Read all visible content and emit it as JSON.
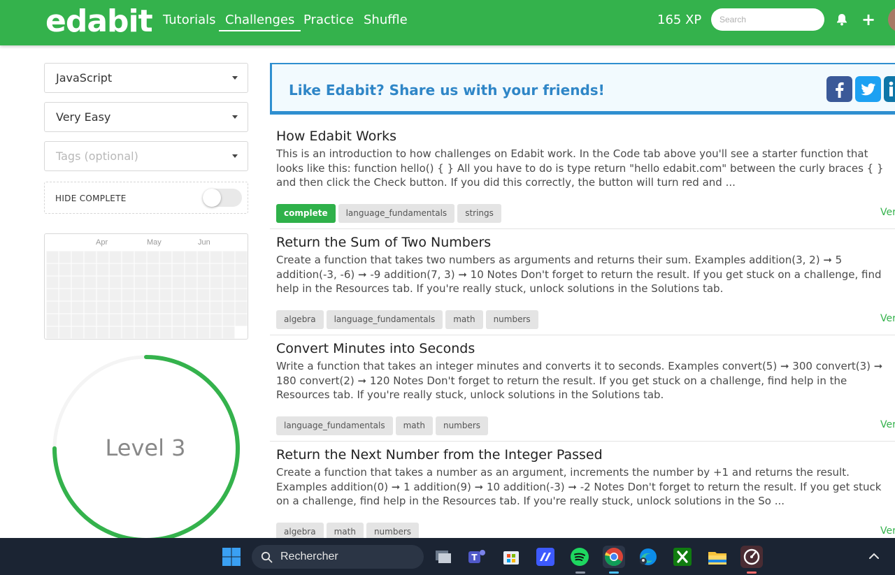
{
  "header": {
    "logo": "edabit",
    "nav": [
      "Tutorials",
      "Challenges",
      "Practice",
      "Shuffle"
    ],
    "active_nav": "Challenges",
    "xp": "165 XP",
    "search_placeholder": "Search"
  },
  "sidebar": {
    "language": "JavaScript",
    "difficulty": "Very Easy",
    "tags_placeholder": "Tags (optional)",
    "hide_complete": "HIDE COMPLETE",
    "hide_complete_on": false,
    "months": [
      "Apr",
      "May",
      "Jun"
    ],
    "level": "Level 3",
    "level_progress": 0.75
  },
  "share": {
    "text": "Like Edabit? Share us with your friends!",
    "icons": [
      "facebook-icon",
      "twitter-icon",
      "linkedin-icon"
    ]
  },
  "challenges": [
    {
      "title": "How Edabit Works",
      "description": "This is an introduction to how challenges on Edabit work. In the Code tab above you'll see a starter function that looks like this: function hello() { } All you have to do is type return \"hello edabit.com\" between the curly braces { } and then click the Check button. If you did this correctly, the button will turn red and ...",
      "tags": [
        "complete",
        "language_fundamentals",
        "strings"
      ],
      "difficulty": "Very E"
    },
    {
      "title": "Return the Sum of Two Numbers",
      "description": "Create a function that takes two numbers as arguments and returns their sum. Examples addition(3, 2) ➞ 5 addition(-3, -6) ➞ -9 addition(7, 3) ➞ 10 Notes Don't forget to return the result. If you get stuck on a challenge, find help in the Resources tab. If you're really stuck, unlock solutions in the Solutions tab.",
      "tags": [
        "algebra",
        "language_fundamentals",
        "math",
        "numbers"
      ],
      "difficulty": "Very E"
    },
    {
      "title": "Convert Minutes into Seconds",
      "description": "Write a function that takes an integer minutes and converts it to seconds. Examples convert(5) ➞ 300 convert(3) ➞ 180 convert(2) ➞ 120 Notes Don't forget to return the result. If you get stuck on a challenge, find help in the Resources tab. If you're really stuck, unlock solutions in the Solutions tab.",
      "tags": [
        "language_fundamentals",
        "math",
        "numbers"
      ],
      "difficulty": "Very E"
    },
    {
      "title": "Return the Next Number from the Integer Passed",
      "description": "Create a function that takes a number as an argument, increments the number by +1 and returns the result. Examples addition(0) ➞ 1 addition(9) ➞ 10 addition(-3) ➞ -2 Notes Don't forget to return the result. If you get stuck on a challenge, find help in the Resources tab. If you're really stuck, unlock solutions in the So ...",
      "tags": [
        "algebra",
        "math",
        "numbers"
      ],
      "difficulty": "Very E"
    }
  ],
  "taskbar": {
    "search_text": "Rechercher",
    "apps": [
      "windows-start-icon",
      "task-view-icon",
      "teams-icon",
      "store-icon",
      "vscode-icon",
      "spotify-icon",
      "chrome-icon",
      "edge-icon",
      "xbox-icon",
      "file-explorer-icon",
      "recorder-icon"
    ],
    "colors": {
      "brand": "#34b24c",
      "link": "#2f86c7",
      "taskbar": "#1b2433"
    }
  }
}
